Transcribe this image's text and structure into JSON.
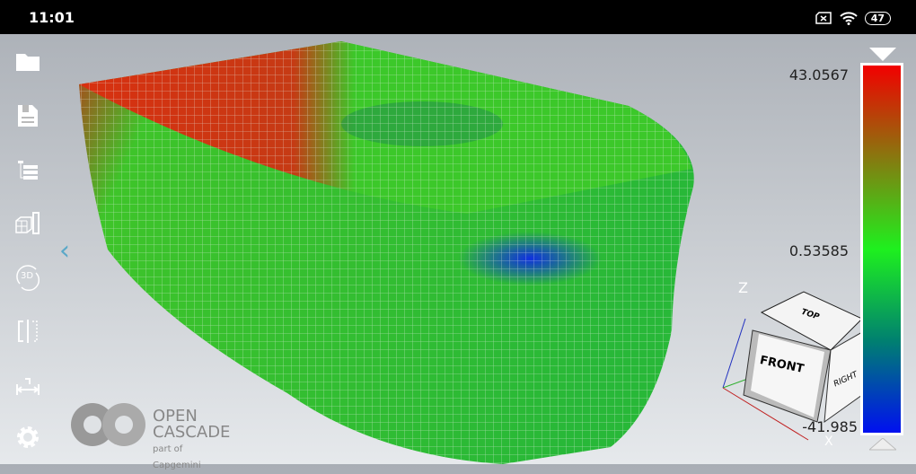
{
  "status_bar": {
    "time": "11:01",
    "battery": "47",
    "icons": [
      "sim-none-icon",
      "wifi-icon",
      "battery-icon"
    ]
  },
  "sidebar": {
    "items": [
      {
        "name": "open-file-icon"
      },
      {
        "name": "save-icon"
      },
      {
        "name": "model-tree-icon"
      },
      {
        "name": "mesh-display-icon"
      },
      {
        "name": "rotate-3d-icon"
      },
      {
        "name": "clipping-plane-icon"
      },
      {
        "name": "measure-icon"
      },
      {
        "name": "settings-icon"
      }
    ],
    "rotate_label": "3D"
  },
  "color_scale": {
    "max": "43.0567",
    "mid": "0.53585",
    "min": "-41.985",
    "colors": [
      "#f20000",
      "#1ef01e",
      "#008070",
      "#0010f0"
    ]
  },
  "view_cube": {
    "top": "TOP",
    "front": "FRONT",
    "right": "RIGHT",
    "axis_z": "Z",
    "axis_x": "X"
  },
  "logo": {
    "line1": "OPEN",
    "line2": "CASCADE",
    "line3": "part of Capgemini"
  }
}
